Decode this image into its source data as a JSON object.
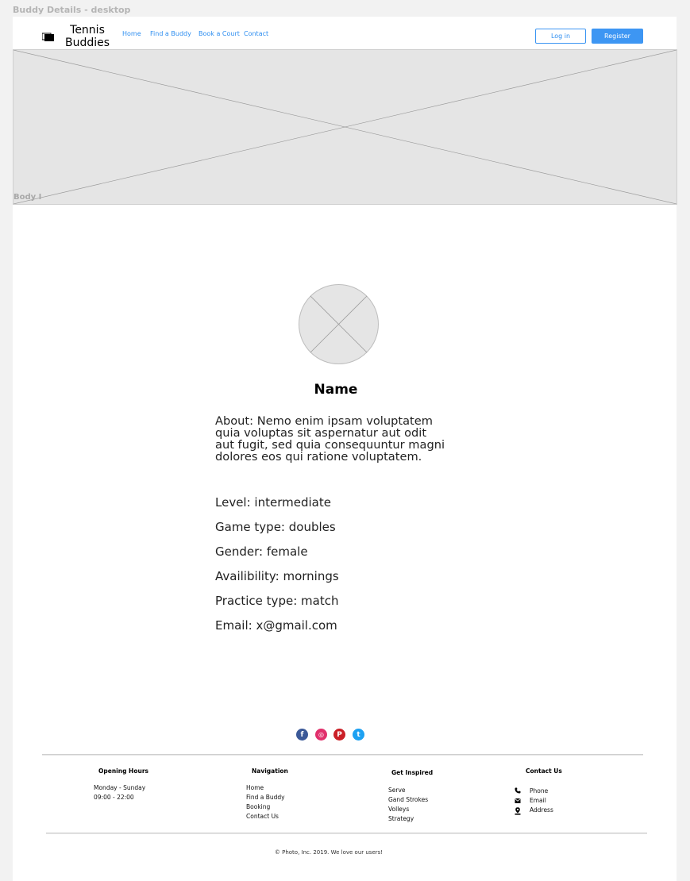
{
  "frame_label": "Buddy Details - desktop",
  "header": {
    "logo_line1": "Tennis",
    "logo_line2": "Buddies",
    "nav": [
      "Home",
      "Find a  Buddy",
      "Book a Court",
      "Contact"
    ],
    "login_label": "Log in",
    "register_label": "Register"
  },
  "hero": {
    "label": "Body I"
  },
  "profile": {
    "name": "Name",
    "about": "About: Nemo enim ipsam voluptatem quia voluptas sit aspernatur aut odit aut fugit, sed quia consequuntur magni dolores eos qui ratione voluptatem.",
    "level": "Level: intermediate",
    "game_type": "Game type: doubles",
    "gender": "Gender: female",
    "availability": "Availibility: mornings",
    "practice_type": "Practice type: match",
    "email": "Email: x@gmail.com"
  },
  "social": {
    "icons": [
      "facebook-icon",
      "instagram-icon",
      "pinterest-icon",
      "twitter-icon"
    ],
    "facebook_glyph": "f",
    "instagram_glyph": "◎",
    "pinterest_glyph": "P",
    "twitter_glyph": "t",
    "colors": {
      "facebook": "#3b5998",
      "instagram": "#e1306c",
      "pinterest": "#cb2027",
      "twitter": "#1da1f2"
    }
  },
  "footer": {
    "opening_hours": {
      "title": "Opening Hours",
      "days": "Monday - Sunday",
      "hours": "09:00 - 22:00"
    },
    "navigation": {
      "title": "Navigation",
      "items": [
        "Home",
        "Find a Buddy",
        "Booking",
        "Contact Us"
      ]
    },
    "get_inspired": {
      "title": "Get Inspired",
      "items": [
        "Serve",
        "Gand Strokes",
        "Volleys",
        "Strategy"
      ]
    },
    "contact_us": {
      "title": "Contact Us",
      "phone": "Phone",
      "email": "Email",
      "address": "Address"
    },
    "copyright": "© Photo, Inc. 2019. We love our users!"
  },
  "colors": {
    "accent": "#3d96f3",
    "placeholder": "#e5e5e5"
  }
}
